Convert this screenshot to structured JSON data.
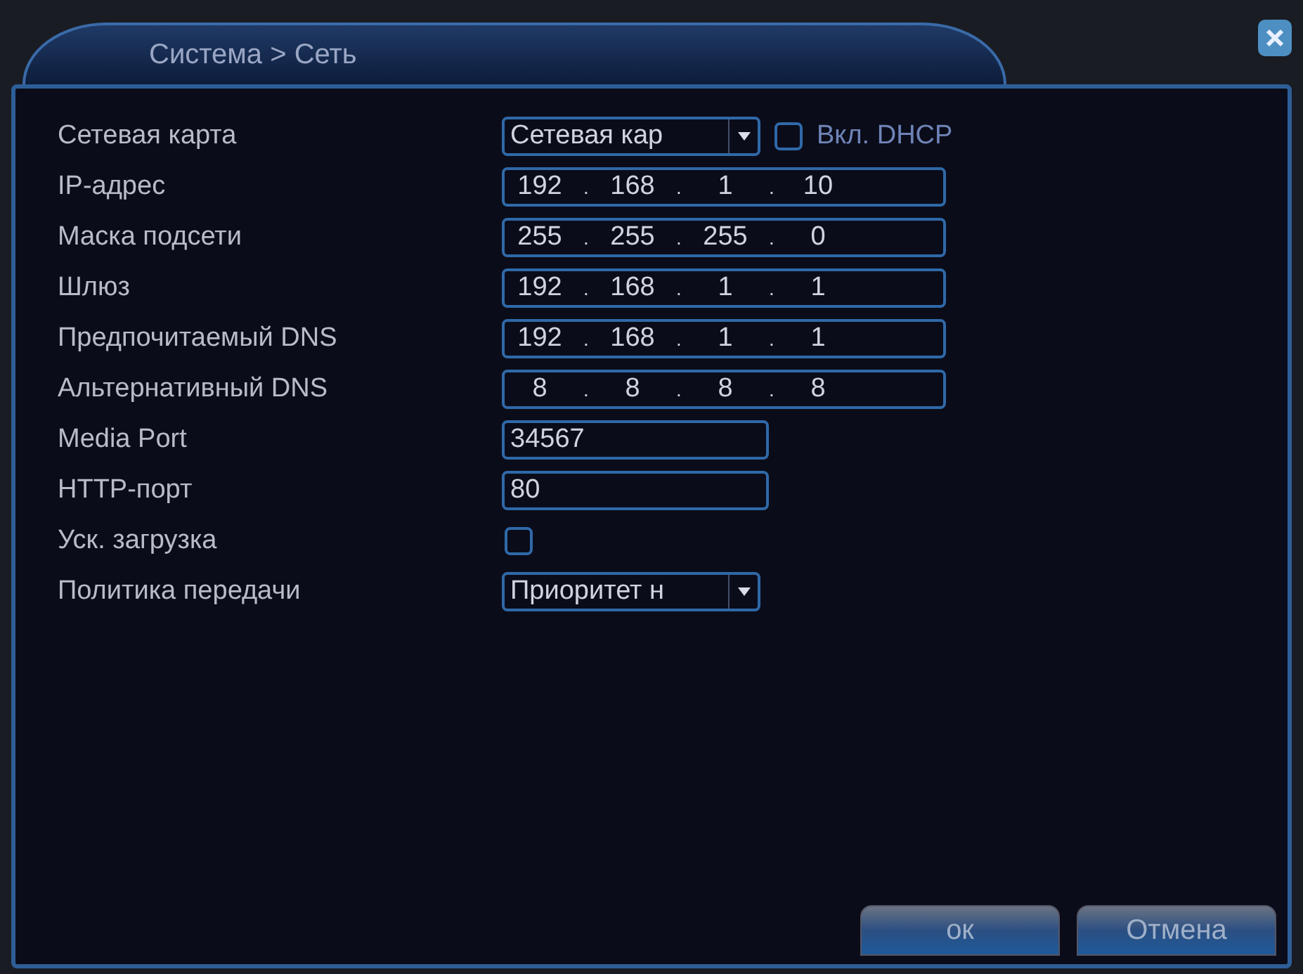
{
  "window": {
    "title": "Система > Сеть"
  },
  "fields": [
    {
      "kind": "select",
      "label": "Сетевая карта",
      "value": "Сетевая кар",
      "checkbox": {
        "label": "Вкл. DHCP",
        "checked": false
      }
    },
    {
      "kind": "ip",
      "label": "IP-адрес",
      "parts": [
        "192",
        ".",
        "168",
        ".",
        "1",
        ".",
        "10"
      ]
    },
    {
      "kind": "ip",
      "label": "Маска подсети",
      "parts": [
        "255",
        ".",
        "255",
        ".",
        "255",
        ".",
        "0"
      ]
    },
    {
      "kind": "ip",
      "label": "Шлюз",
      "parts": [
        "192",
        ".",
        "168",
        ".",
        "1",
        ".",
        "1"
      ]
    },
    {
      "kind": "ip",
      "label": "Предпочитаемый DNS",
      "parts": [
        "192",
        ".",
        "168",
        ".",
        "1",
        ".",
        "1"
      ]
    },
    {
      "kind": "ip",
      "label": "Альтернативный DNS",
      "parts": [
        "8",
        ".",
        "8",
        ".",
        "8",
        ".",
        "8"
      ]
    },
    {
      "kind": "text",
      "label": "Media Port",
      "value": "34567"
    },
    {
      "kind": "text",
      "label": "HTTP-порт",
      "value": "80"
    },
    {
      "kind": "checkbox",
      "label": "Уск. загрузка",
      "checked": false
    },
    {
      "kind": "select",
      "label": "Политика передачи",
      "value": "Приоритет н"
    }
  ],
  "buttons": [
    "ок",
    "Отмена"
  ]
}
